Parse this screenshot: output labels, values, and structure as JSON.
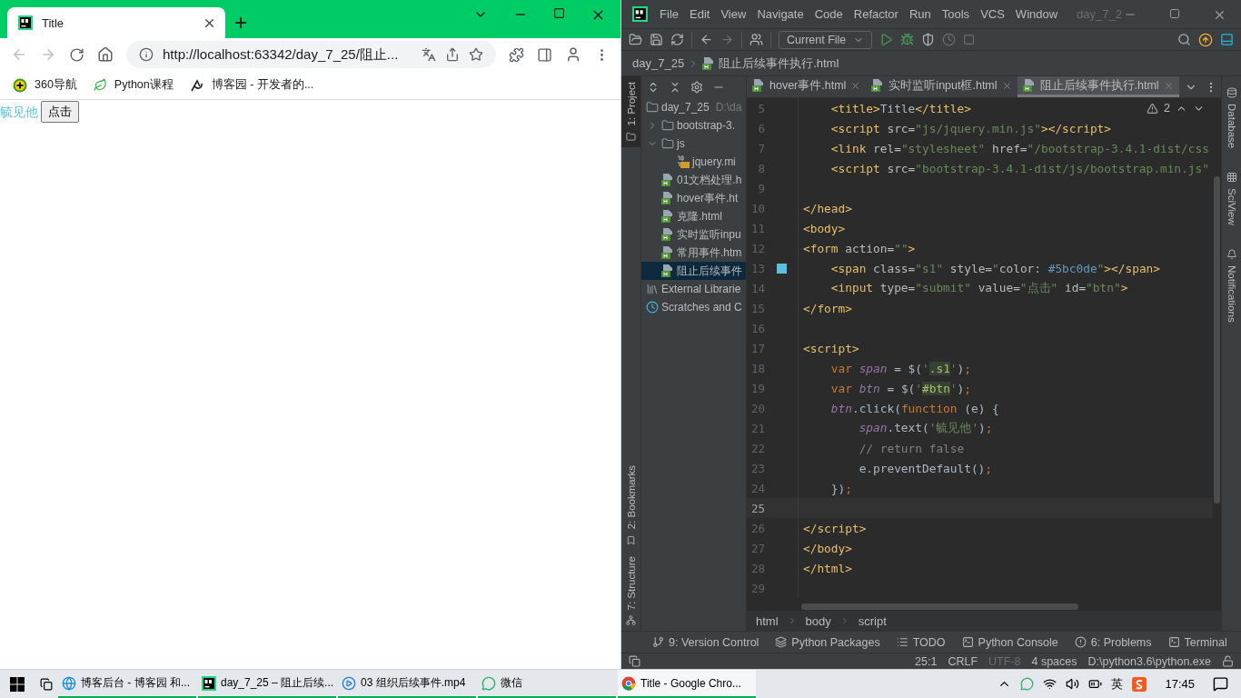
{
  "browser": {
    "tabs": [
      {
        "title": "Title",
        "selected": true
      }
    ],
    "nav": {
      "back_enabled": false,
      "forward_enabled": false
    },
    "address": "http://localhost:63342/day_7_25/阻止...",
    "bookmarks": [
      {
        "kind": "nav360",
        "label": "360导航"
      },
      {
        "kind": "leaf",
        "label": "Python课程"
      },
      {
        "kind": "blog",
        "label": "博客园 - 开发者的..."
      }
    ],
    "page": {
      "span_text": "毓见他",
      "button": "点击"
    }
  },
  "ide": {
    "menu": [
      "File",
      "Edit",
      "View",
      "Navigate",
      "Code",
      "Refactor",
      "Run",
      "Tools",
      "VCS",
      "Window"
    ],
    "title": "day_7_2",
    "run_config": "Current File",
    "breadcrumb": [
      "day_7_25",
      "阻止后续事件执行.html"
    ],
    "left_tools": [
      {
        "label": "1: Project",
        "selected": true
      },
      {
        "label": "2: Bookmarks",
        "selected": false
      },
      {
        "label": "7: Structure",
        "selected": false
      }
    ],
    "project_tree": [
      {
        "kind": "folder",
        "label": "day_7_25",
        "detail": "D:\\da",
        "selected": false,
        "children": [
          {
            "kind": "folder",
            "label": "bootstrap-3.",
            "expanded": false,
            "selected": false
          },
          {
            "kind": "folder",
            "label": "js",
            "expanded": true,
            "selected": false,
            "children": [
              {
                "kind": "js",
                "label": "jquery.mi",
                "selected": false
              }
            ]
          },
          {
            "kind": "html",
            "label": "01文档处理.h",
            "selected": false
          },
          {
            "kind": "html",
            "label": "hover事件.ht",
            "selected": false
          },
          {
            "kind": "html",
            "label": "克隆.html",
            "selected": false
          },
          {
            "kind": "html",
            "label": "实时监听inpu",
            "selected": false
          },
          {
            "kind": "html",
            "label": "常用事件.htm",
            "selected": false
          },
          {
            "kind": "html",
            "label": "阻止后续事件",
            "selected": true
          }
        ]
      },
      {
        "kind": "library",
        "label": "External Librarie",
        "selected": false
      },
      {
        "kind": "scratches",
        "label": "Scratches and C",
        "selected": false
      }
    ],
    "editor_tabs": [
      {
        "label": "hover事件.html",
        "selected": false
      },
      {
        "label": "实时监听input框.html",
        "selected": false
      },
      {
        "label": "阻止后续事件执行.html",
        "selected": true
      }
    ],
    "inspection": "2",
    "code_lines": [
      {
        "number": "5",
        "current": false,
        "tokens": [
          {
            "kind": "tag",
            "text": "    <title>"
          },
          {
            "kind": "plain",
            "text": "Title"
          },
          {
            "kind": "tag",
            "text": "</title>"
          }
        ]
      },
      {
        "number": "6",
        "current": false,
        "tokens": [
          {
            "kind": "tag",
            "text": "    <script"
          },
          {
            "kind": "attr",
            "text": " src="
          },
          {
            "kind": "string",
            "text": "\"js/jquery.min.js\""
          },
          {
            "kind": "tag",
            "text": "></script>"
          }
        ]
      },
      {
        "number": "7",
        "current": false,
        "tokens": [
          {
            "kind": "tag",
            "text": "    <link"
          },
          {
            "kind": "attr",
            "text": " rel="
          },
          {
            "kind": "string",
            "text": "\"stylesheet\""
          },
          {
            "kind": "attr",
            "text": " href="
          },
          {
            "kind": "string",
            "text": "\"/bootstrap-3.4.1-dist/css"
          }
        ]
      },
      {
        "number": "8",
        "current": false,
        "tokens": [
          {
            "kind": "tag",
            "text": "    <script"
          },
          {
            "kind": "attr",
            "text": " src="
          },
          {
            "kind": "string",
            "text": "\"bootstrap-3.4.1-dist/js/bootstrap.min.js\""
          }
        ]
      },
      {
        "number": "9",
        "current": false
      },
      {
        "number": "10",
        "current": false,
        "tokens": [
          {
            "kind": "tag",
            "text": "</head>"
          }
        ]
      },
      {
        "number": "11",
        "current": false,
        "tokens": [
          {
            "kind": "tag",
            "text": "<body>"
          }
        ]
      },
      {
        "number": "12",
        "current": false,
        "tokens": [
          {
            "kind": "tag",
            "text": "<form"
          },
          {
            "kind": "attr",
            "text": " action="
          },
          {
            "kind": "string",
            "text": "\"\""
          },
          {
            "kind": "tag",
            "text": ">"
          }
        ]
      },
      {
        "number": "13",
        "current": false,
        "tokens": [
          {
            "kind": "tag",
            "text": "    <span"
          },
          {
            "kind": "attr",
            "text": " class="
          },
          {
            "kind": "string",
            "text": "\"s1\""
          },
          {
            "kind": "attr",
            "text": " style="
          },
          {
            "kind": "string",
            "text": "\""
          },
          {
            "kind": "attr",
            "text": "color: "
          },
          {
            "kind": "hex",
            "text": "#5bc0de"
          },
          {
            "kind": "string",
            "text": "\""
          },
          {
            "kind": "tag",
            "text": "></span>"
          }
        ]
      },
      {
        "number": "14",
        "current": false,
        "tokens": [
          {
            "kind": "tag",
            "text": "    <input"
          },
          {
            "kind": "attr",
            "text": " type="
          },
          {
            "kind": "string",
            "text": "\"submit\""
          },
          {
            "kind": "attr",
            "text": " value="
          },
          {
            "kind": "string",
            "text": "\"点击\""
          },
          {
            "kind": "attr",
            "text": " id="
          },
          {
            "kind": "string",
            "text": "\"btn\""
          },
          {
            "kind": "tag",
            "text": ">"
          }
        ]
      },
      {
        "number": "15",
        "current": false,
        "tokens": [
          {
            "kind": "tag",
            "text": "</form>"
          }
        ]
      },
      {
        "number": "16",
        "current": false
      },
      {
        "number": "17",
        "current": false,
        "tokens": [
          {
            "kind": "tag",
            "text": "<script>"
          }
        ]
      },
      {
        "number": "18",
        "current": false,
        "tokens": [
          {
            "kind": "keyword",
            "text": "    var"
          },
          {
            "kind": "var",
            "text": " span"
          },
          {
            "kind": "plain",
            "text": " = $("
          },
          {
            "kind": "string",
            "text": "'"
          },
          {
            "kind": "selector",
            "text": ".s1"
          },
          {
            "kind": "string",
            "text": "'"
          },
          {
            "kind": "plain",
            "text": ")"
          },
          {
            "kind": "keyword",
            "text": ";"
          }
        ]
      },
      {
        "number": "19",
        "current": false,
        "tokens": [
          {
            "kind": "keyword",
            "text": "    var"
          },
          {
            "kind": "var",
            "text": " btn"
          },
          {
            "kind": "plain",
            "text": " = $("
          },
          {
            "kind": "string",
            "text": "'"
          },
          {
            "kind": "selector",
            "text": "#btn"
          },
          {
            "kind": "string",
            "text": "'"
          },
          {
            "kind": "plain",
            "text": ")"
          },
          {
            "kind": "keyword",
            "text": ";"
          }
        ]
      },
      {
        "number": "20",
        "current": false,
        "tokens": [
          {
            "kind": "var",
            "text": "    btn"
          },
          {
            "kind": "plain",
            "text": ".click("
          },
          {
            "kind": "keyword",
            "text": "function"
          },
          {
            "kind": "plain",
            "text": " (e) {"
          }
        ]
      },
      {
        "number": "21",
        "current": false,
        "tokens": [
          {
            "kind": "var",
            "text": "        span"
          },
          {
            "kind": "plain",
            "text": ".text("
          },
          {
            "kind": "string",
            "text": "'毓见他'"
          },
          {
            "kind": "plain",
            "text": ")"
          },
          {
            "kind": "keyword",
            "text": ";"
          }
        ]
      },
      {
        "number": "22",
        "current": false,
        "tokens": [
          {
            "kind": "comment",
            "text": "        // return false"
          }
        ]
      },
      {
        "number": "23",
        "current": false,
        "tokens": [
          {
            "kind": "plain",
            "text": "        e.preventDefault()"
          },
          {
            "kind": "keyword",
            "text": ";"
          }
        ]
      },
      {
        "number": "24",
        "current": false,
        "tokens": [
          {
            "kind": "plain",
            "text": "    })"
          },
          {
            "kind": "keyword",
            "text": ";"
          }
        ]
      },
      {
        "number": "25",
        "current": true
      },
      {
        "number": "26",
        "current": false,
        "tokens": [
          {
            "kind": "tag",
            "text": "</script>"
          }
        ]
      },
      {
        "number": "27",
        "current": false,
        "tokens": [
          {
            "kind": "tag",
            "text": "</body>"
          }
        ]
      },
      {
        "number": "28",
        "current": false,
        "tokens": [
          {
            "kind": "tag",
            "text": "</html>"
          }
        ]
      },
      {
        "number": "29",
        "current": false
      }
    ],
    "code_breadcrumb": [
      "html",
      "body",
      "script"
    ],
    "tool_windows": [
      {
        "kind": "vcs",
        "label": "9: Version Control"
      },
      {
        "kind": "packages",
        "label": "Python Packages"
      },
      {
        "kind": "todo",
        "label": "TODO"
      },
      {
        "kind": "console",
        "label": "Python Console"
      },
      {
        "kind": "problems",
        "label": "6: Problems"
      },
      {
        "kind": "terminal",
        "label": "Terminal"
      }
    ],
    "status": [
      {
        "label": "25:1",
        "disabled": false
      },
      {
        "label": "CRLF",
        "disabled": false
      },
      {
        "label": "UTF-8",
        "disabled": true
      },
      {
        "label": "4 spaces",
        "disabled": false
      },
      {
        "label": "D:\\python3.6\\python.exe",
        "disabled": false
      }
    ],
    "right_tools": [
      {
        "kind": "database",
        "label": "Database"
      },
      {
        "kind": "sciview",
        "label": "SciView"
      },
      {
        "kind": "notifications",
        "label": "Notifications"
      }
    ]
  },
  "taskbar": {
    "apps": [
      {
        "kind": "edge",
        "label": "博客后台 - 博客园 和...",
        "selected": false
      },
      {
        "kind": "pycharm",
        "label": "day_7_25 – 阻止后续...",
        "selected": false
      },
      {
        "kind": "player",
        "label": "03 组织后续事件.mp4",
        "selected": false
      },
      {
        "kind": "wechat",
        "label": "微信",
        "selected": false
      },
      {
        "kind": "chrome",
        "label": "Title - Google Chro...",
        "selected": true
      }
    ],
    "ime": "英",
    "clock": "17:45"
  }
}
